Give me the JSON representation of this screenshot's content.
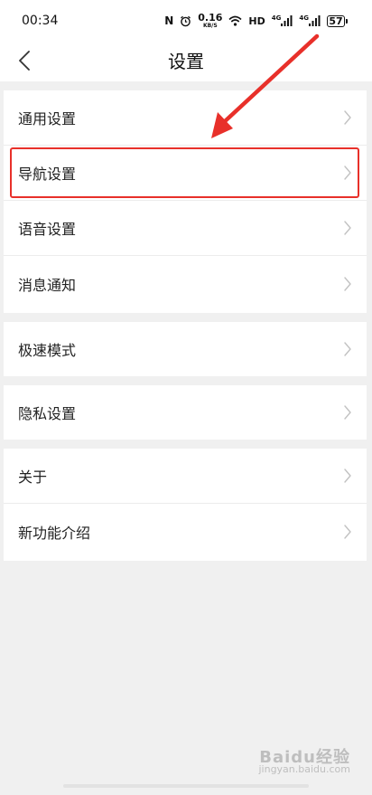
{
  "status_bar": {
    "time": "00:34",
    "icons": [
      "nfc-icon",
      "alarm-icon",
      "wifi-icon",
      "hd-icon",
      "signal-4g-icon",
      "signal-4g-icon",
      "battery-icon"
    ],
    "nfc_label": "N",
    "net_speed_value": "0.16",
    "net_speed_unit": "KB/S",
    "hd_label": "HD",
    "signal_1_label": "4G",
    "signal_2_label": "4G",
    "battery_level": "57"
  },
  "header": {
    "title": "设置"
  },
  "groups": [
    {
      "items": [
        {
          "label": "通用设置"
        },
        {
          "label": "导航设置"
        },
        {
          "label": "语音设置"
        },
        {
          "label": "消息通知"
        }
      ]
    },
    {
      "items": [
        {
          "label": "极速模式"
        }
      ]
    },
    {
      "items": [
        {
          "label": "隐私设置"
        }
      ]
    },
    {
      "items": [
        {
          "label": "关于"
        },
        {
          "label": "新功能介绍"
        }
      ]
    }
  ],
  "annotation": {
    "highlight_color": "#e8302a",
    "highlighted_item": "导航设置"
  },
  "watermark": {
    "main": "Baidu经验",
    "sub": "jingyan.baidu.com"
  }
}
